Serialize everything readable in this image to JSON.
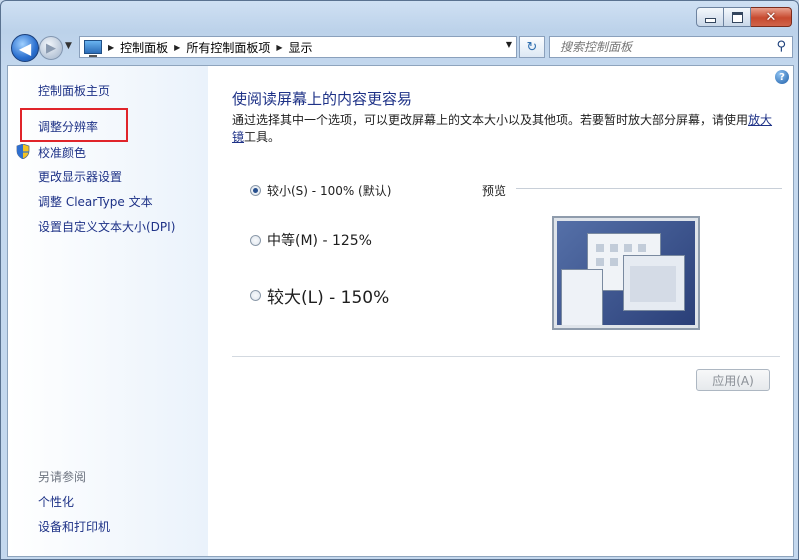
{
  "window": {
    "minimize_icon": "minimize-icon",
    "maximize_icon": "maximize-icon",
    "close_icon": "close-icon"
  },
  "navigation": {
    "breadcrumbs": [
      "控制面板",
      "所有控制面板项",
      "显示"
    ],
    "search_placeholder": "搜索控制面板"
  },
  "sidebar": {
    "home": "控制面板主页",
    "links": [
      "调整分辨率",
      "校准颜色",
      "更改显示器设置",
      "调整 ClearType 文本",
      "设置自定义文本大小(DPI)"
    ],
    "see_also_title": "另请参阅",
    "see_also": [
      "个性化",
      "设备和打印机"
    ]
  },
  "main": {
    "title": "使阅读屏幕上的内容更容易",
    "description_prefix": "通过选择其中一个选项，可以更改屏幕上的文本大小以及其他项。若要暂时放大部分屏幕，请使用",
    "description_link": "放大镜",
    "description_suffix": "工具。",
    "options": [
      {
        "label": "较小(S) - 100% (默认)",
        "checked": true
      },
      {
        "label": "中等(M) - 125%",
        "checked": false
      },
      {
        "label": "较大(L) - 150%",
        "checked": false
      }
    ],
    "preview_label": "预览",
    "apply_label": "应用(A)"
  },
  "colors": {
    "link": "#1e3287",
    "highlight_box": "#e0242a",
    "accent": "#2a6fcf"
  }
}
